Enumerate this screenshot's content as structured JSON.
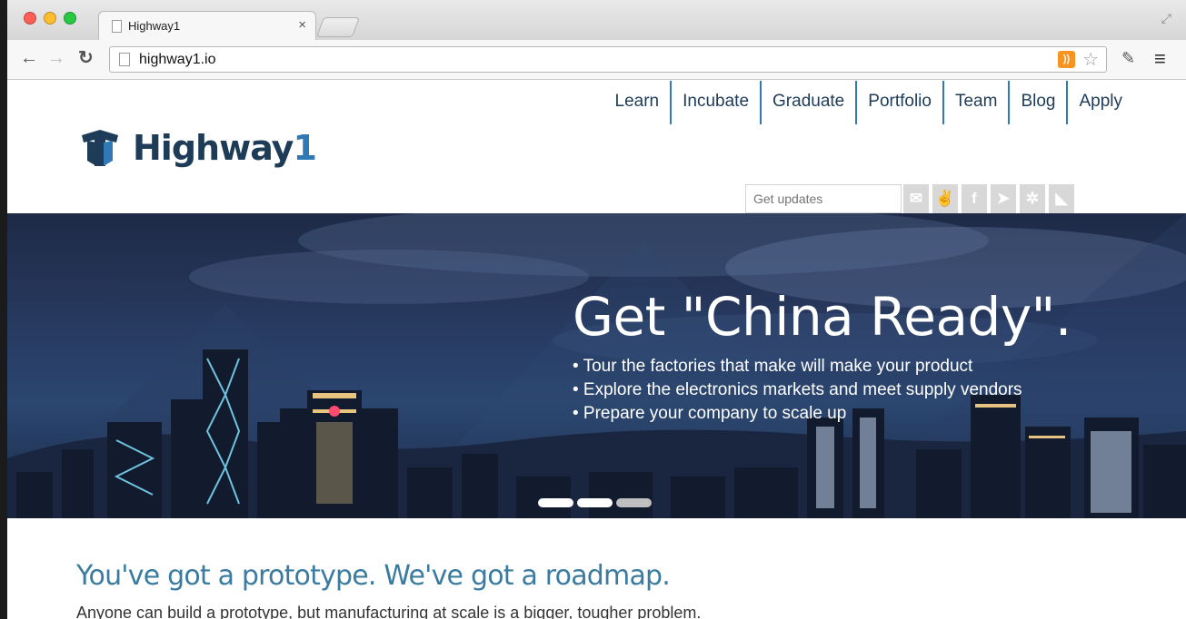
{
  "browser": {
    "tab_title": "Highway1",
    "tab_close": "×",
    "url": "highway1.io",
    "rss_glyph": "RSS"
  },
  "nav": {
    "items": [
      "Learn",
      "Incubate",
      "Graduate",
      "Portfolio",
      "Team",
      "Blog",
      "Apply"
    ]
  },
  "logo": {
    "text": "Highway",
    "number": "1"
  },
  "subscribe": {
    "placeholder": "Get updates"
  },
  "hero": {
    "title": "Get \"China Ready\".",
    "bullets": [
      "• Tour the factories that make will make your product",
      "• Explore the electronics markets and meet supply vendors",
      "• Prepare your company to scale up"
    ],
    "slides": 3,
    "active_slide": 3
  },
  "section": {
    "title": "You've got a prototype. We've got a roadmap.",
    "intro": "Anyone can build a prototype, but manufacturing at scale is a bigger, tougher problem."
  },
  "colors": {
    "brand_dark": "#1e3b57",
    "brand_blue": "#2f79b4",
    "tagline": "#3a7ba0"
  }
}
